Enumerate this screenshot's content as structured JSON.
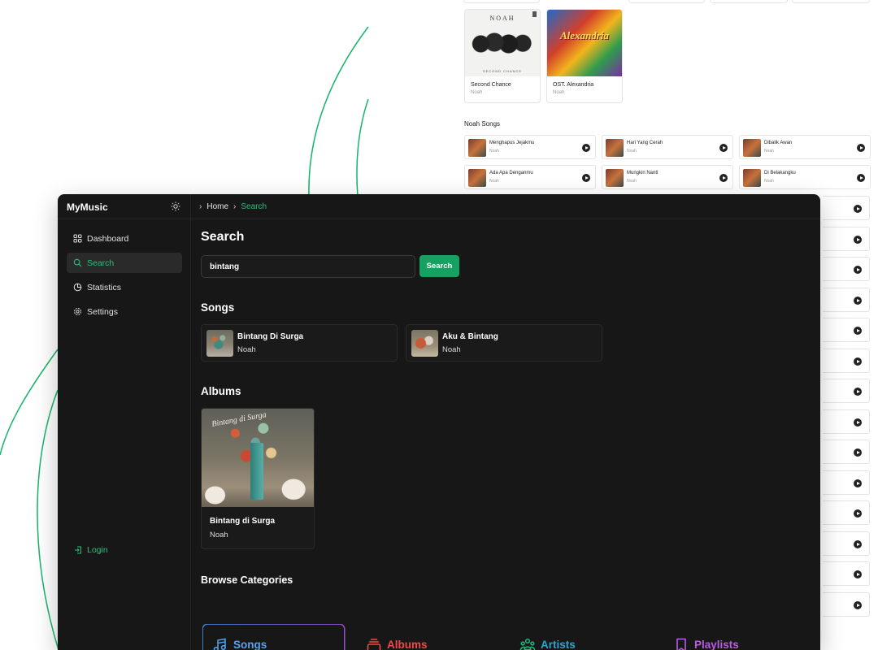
{
  "background_page": {
    "albums": [
      {
        "title": "Second Chance",
        "artist": "Noah",
        "cover_brand": "NOAH",
        "cover_sub": "SECOND CHANCE"
      },
      {
        "title": "OST. Alexandria",
        "artist": "Noah",
        "cover_word": "Alexandria"
      }
    ],
    "section_title": "Noah Songs",
    "songs": [
      {
        "title": "Menghapus Jejakmu",
        "artist": "Noah"
      },
      {
        "title": "Hari Yang Cerah",
        "artist": "Noah"
      },
      {
        "title": "Dibalik Awan",
        "artist": "Noah"
      },
      {
        "title": "Ada Apa Denganmu",
        "artist": "Noah"
      },
      {
        "title": "Mungkin Nanti",
        "artist": "Noah"
      },
      {
        "title": "Di Belakangku",
        "artist": "Noah"
      }
    ]
  },
  "app": {
    "logo": "MyMusic",
    "nav": [
      {
        "label": "Dashboard",
        "icon": "grid-icon",
        "active": false
      },
      {
        "label": "Search",
        "icon": "search-icon",
        "active": true
      },
      {
        "label": "Statistics",
        "icon": "pie-chart-icon",
        "active": false
      },
      {
        "label": "Settings",
        "icon": "gear-icon",
        "active": false
      }
    ],
    "login_label": "Login",
    "breadcrumb": {
      "home": "Home",
      "current": "Search"
    },
    "page_title": "Search",
    "search": {
      "value": "bintang",
      "button_label": "Search"
    },
    "songs_title": "Songs",
    "songs": [
      {
        "title": "Bintang Di Surga",
        "artist": "Noah"
      },
      {
        "title": "Aku & Bintang",
        "artist": "Noah"
      }
    ],
    "albums_title": "Albums",
    "albums": [
      {
        "title": "Bintang di Surga",
        "artist": "Noah",
        "cover_script": "Bintang di Surga"
      }
    ],
    "categories_title": "Browse Categories",
    "categories": [
      {
        "label": "Songs",
        "icon": "music-note-icon",
        "color": "#5aa1f0"
      },
      {
        "label": "Albums",
        "icon": "album-stack-icon",
        "color": "#f0484a"
      },
      {
        "label": "Artists",
        "icon": "users-icon",
        "color": "#2aa5d0"
      },
      {
        "label": "Playlists",
        "icon": "bookmark-icon",
        "color": "#b85de0"
      }
    ]
  },
  "colors": {
    "accent": "#22c27a",
    "button": "#16a062",
    "app_bg": "#171717",
    "decor_line": "#16b56a"
  }
}
